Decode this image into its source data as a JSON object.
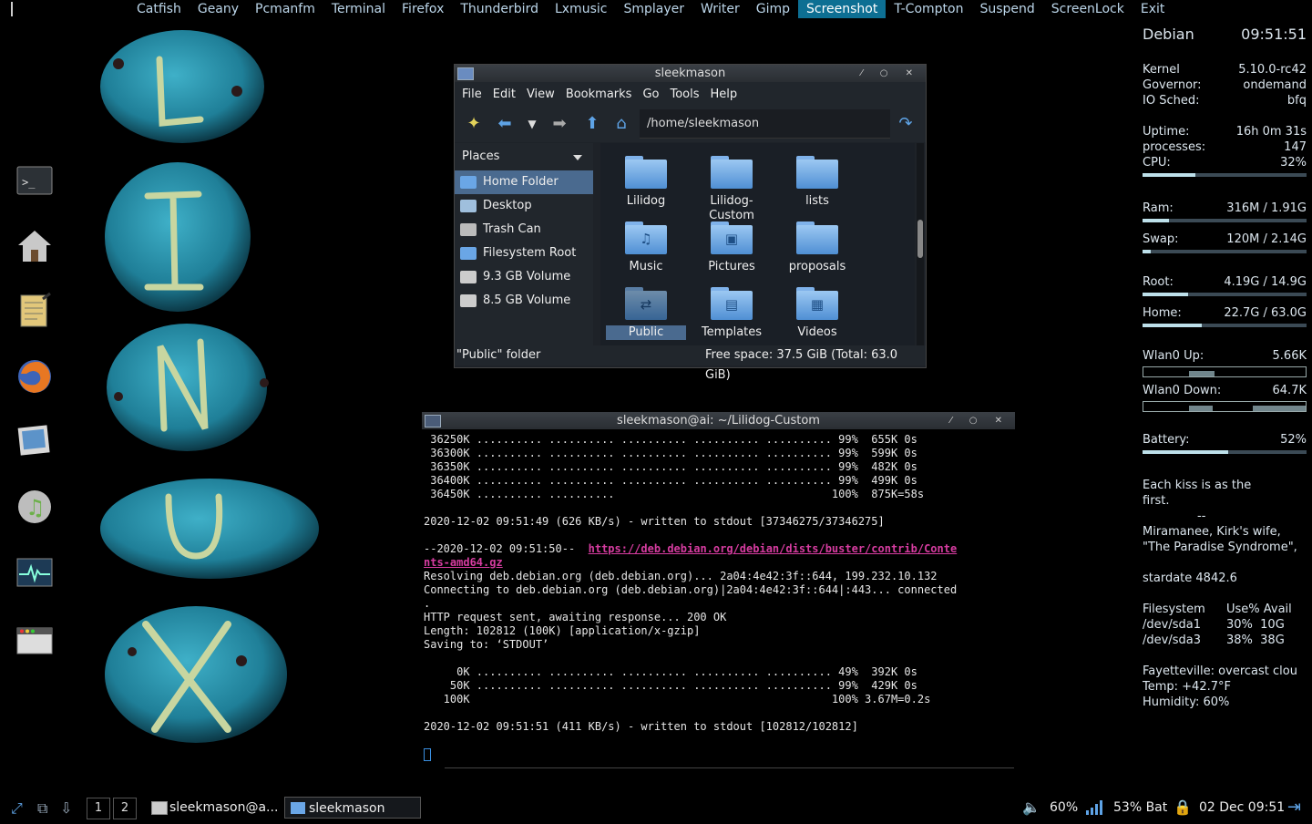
{
  "topbar": {
    "items": [
      "Catfish",
      "Geany",
      "Pcmanfm",
      "Terminal",
      "Firefox",
      "Thunderbird",
      "Lxmusic",
      "Smplayer",
      "Writer",
      "Gimp",
      "Screenshot",
      "T-Compton",
      "Suspend",
      "ScreenLock",
      "Exit"
    ],
    "active": "Screenshot"
  },
  "wallpaper": {
    "letters": [
      "L",
      "I",
      "N",
      "U",
      "X"
    ]
  },
  "dock": [
    "terminal-icon",
    "home-folder-icon",
    "text-editor-icon",
    "firefox-icon",
    "image-viewer-icon",
    "music-player-icon",
    "system-monitor-icon",
    "window-manager-icon"
  ],
  "filemanager": {
    "title": "sleekmason",
    "menu": [
      "File",
      "Edit",
      "View",
      "Bookmarks",
      "Go",
      "Tools",
      "Help"
    ],
    "path": "/home/sleekmason",
    "places_header": "Places",
    "places": [
      "Home Folder",
      "Desktop",
      "Trash Can",
      "Filesystem Root",
      "9.3 GB Volume",
      "8.5 GB Volume"
    ],
    "selected_place": "Home Folder",
    "files": [
      {
        "name": "Lilidog",
        "glyph": ""
      },
      {
        "name": "Lilidog-Custom",
        "glyph": ""
      },
      {
        "name": "lists",
        "glyph": ""
      },
      {
        "name": "Music",
        "glyph": "♫"
      },
      {
        "name": "Pictures",
        "glyph": "▣"
      },
      {
        "name": "proposals",
        "glyph": ""
      },
      {
        "name": "Public",
        "glyph": "⇄"
      },
      {
        "name": "Templates",
        "glyph": "▤"
      },
      {
        "name": "Videos",
        "glyph": "▦"
      }
    ],
    "selected_file": "Public",
    "status_left": "\"Public\" folder",
    "status_right": "Free space: 37.5 GiB (Total: 63.0 GiB)"
  },
  "terminal": {
    "title": "sleekmason@ai: ~/Lilidog-Custom",
    "lines_before": [
      " 36250K .......... .......... .......... .......... .......... 99%  655K 0s",
      " 36300K .......... .......... .......... .......... .......... 99%  599K 0s",
      " 36350K .......... .......... .......... .......... .......... 99%  482K 0s",
      " 36400K .......... .......... .......... .......... .......... 99%  499K 0s",
      " 36450K .......... ..........                                 100%  875K=58s",
      "",
      "2020-12-02 09:51:49 (626 KB/s) - written to stdout [37346275/37346275]",
      ""
    ],
    "link_prefix": "--2020-12-02 09:51:50--  ",
    "link_part1": "https://deb.debian.org/debian/dists/buster/contrib/Conte",
    "link_part2": "nts-amd64.gz",
    "lines_after": [
      "Resolving deb.debian.org (deb.debian.org)... 2a04:4e42:3f::644, 199.232.10.132",
      "Connecting to deb.debian.org (deb.debian.org)|2a04:4e42:3f::644|:443... connected",
      ".",
      "HTTP request sent, awaiting response... 200 OK",
      "Length: 102812 (100K) [application/x-gzip]",
      "Saving to: ‘STDOUT’",
      "",
      "     0K .......... .......... .......... .......... .......... 49%  392K 0s",
      "    50K .......... .......... .......... .......... .......... 99%  429K 0s",
      "   100K                                                       100% 3.67M=0.2s",
      "",
      "2020-12-02 09:51:51 (411 KB/s) - written to stdout [102812/102812]"
    ]
  },
  "conky": {
    "host": "Debian",
    "time": "09:51:51",
    "kernel_label": "Kernel",
    "kernel": "5.10.0-rc42",
    "governor_label": "Governor:",
    "governor": "ondemand",
    "iosched_label": "IO Sched:",
    "iosched": "bfq",
    "uptime_label": "Uptime:",
    "uptime": "16h 0m 31s",
    "processes_label": "processes:",
    "processes": "147",
    "cpu_label": "CPU:",
    "cpu": "32%",
    "cpu_fraction": 0.32,
    "ram_label": "Ram:",
    "ram": "316M  / 1.91G",
    "ram_fraction": 0.16,
    "swap_label": "Swap:",
    "swap": "120M  / 2.14G",
    "swap_fraction": 0.05,
    "root_label": "Root:",
    "root": "4.19G / 14.9G",
    "root_fraction": 0.28,
    "home_label": "Home:",
    "home": "22.7G / 63.0G",
    "home_fraction": 0.36,
    "up_label": "Wlan0 Up:",
    "up": "5.66K",
    "down_label": "Wlan0 Down:",
    "down": "64.7K",
    "battery_label": "Battery:",
    "battery": "52%",
    "battery_fraction": 0.52,
    "quote1": "Each kiss is as the",
    "quote2": "first.",
    "quote3": "--",
    "quote4": "Miramanee, Kirk's wife,",
    "quote5": "\"The Paradise Syndrome\",",
    "stardate": "stardate 4842.6",
    "fs_header1": "Filesystem",
    "fs_header2": "Use% Avail",
    "fs1_name": "/dev/sda1",
    "fs1_vals": "30%  10G",
    "fs2_name": "/dev/sda3",
    "fs2_vals": "38%  38G",
    "weather1": "Fayetteville: overcast clou",
    "weather2": "Temp: +42.7°F",
    "weather3": "Humidity: 60%"
  },
  "taskbar": {
    "desktops": [
      "1",
      "2"
    ],
    "tasks": [
      "sleekmason@a...",
      "sleekmason"
    ],
    "volume": "60%",
    "battery": "53% Bat",
    "clock": "02 Dec 09:51"
  },
  "colors": {
    "accent": "#0d6f93",
    "folder": "#6aa6e6",
    "rock": "#2a8fa6"
  }
}
